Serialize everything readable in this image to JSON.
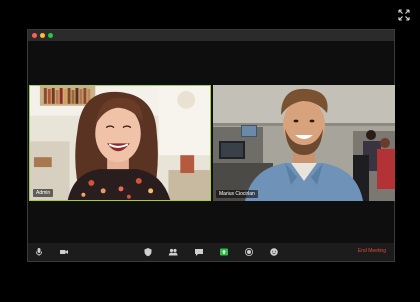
{
  "participants": [
    {
      "name": "Admin",
      "active_speaker": true
    },
    {
      "name": "Marius Ciocirlan",
      "active_speaker": false
    }
  ],
  "toolbar": {
    "end_meeting_label": "End Meeting",
    "buttons": [
      "mic-icon",
      "video-camera-icon",
      "security-icon",
      "participants-icon",
      "chat-icon",
      "share-screen-icon",
      "record-icon",
      "reactions-icon"
    ]
  },
  "colors": {
    "active_speaker_border": "#a5d03a",
    "end_meeting": "#e0493b",
    "share_screen": "#2fbf4a"
  }
}
